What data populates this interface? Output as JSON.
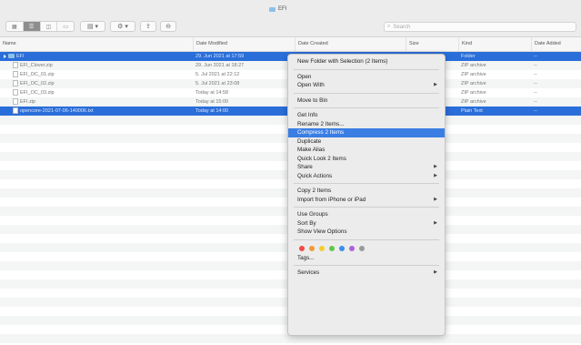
{
  "window": {
    "title": "EFI"
  },
  "toolbar": {
    "search_placeholder": "Search",
    "view_modes": [
      "icon-view-icon",
      "list-view-icon",
      "column-view-icon",
      "gallery-view-icon"
    ]
  },
  "columns": [
    "Name",
    "Date Modified",
    "Date Created",
    "Size",
    "Kind",
    "Date Added"
  ],
  "rows": [
    {
      "name": "EFI",
      "modified": "29. Jun 2021 at 17:59",
      "size": "--",
      "kind": "Folder",
      "added": "--",
      "selected": true,
      "folder": true
    },
    {
      "name": "EFI_Clover.zip",
      "modified": "29. Jun 2021 at 18:27",
      "size": "MB",
      "kind": "ZIP archive",
      "added": "--"
    },
    {
      "name": "EFI_OC_01.zip",
      "modified": "5. Jul 2021 at 22:12",
      "size": "MB",
      "kind": "ZIP archive",
      "added": "--"
    },
    {
      "name": "EFI_OC_02.zip",
      "modified": "5. Jul 2021 at 23:08",
      "size": "MB",
      "kind": "ZIP archive",
      "added": "--"
    },
    {
      "name": "EFI_OC_03.zip",
      "modified": "Today at 14:58",
      "size": "MB",
      "kind": "ZIP archive",
      "added": "--"
    },
    {
      "name": "EFI.zip",
      "modified": "Today at 15:00",
      "size": "MB",
      "kind": "ZIP archive",
      "added": "--"
    },
    {
      "name": "opencore-2021-07-06-140006.txt",
      "modified": "Today at 14:00",
      "size": "KB",
      "kind": "Plain Text",
      "added": "--",
      "selected": true
    }
  ],
  "context_menu": {
    "new_folder": "New Folder with Selection (2 Items)",
    "open": "Open",
    "open_with": "Open With",
    "move_to_bin": "Move to Bin",
    "get_info": "Get Info",
    "rename": "Rename 2 Items...",
    "compress": "Compress 2 Items",
    "duplicate": "Duplicate",
    "make_alias": "Make Alias",
    "quick_look": "Quick Look 2 Items",
    "share": "Share",
    "quick_actions": "Quick Actions",
    "copy": "Copy 2 Items",
    "import_iphone": "Import from iPhone or iPad",
    "use_groups": "Use Groups",
    "sort_by": "Sort By",
    "show_view_options": "Show View Options",
    "tags": "Tags...",
    "services": "Services"
  },
  "tag_colors": [
    "#ee4b47",
    "#f39a34",
    "#f5cd33",
    "#5fc84a",
    "#3c8df0",
    "#ad62d6",
    "#9a9a9a"
  ],
  "colors": {
    "selection": "#2a6ed9",
    "menu_highlight": "#3a7ee4"
  }
}
